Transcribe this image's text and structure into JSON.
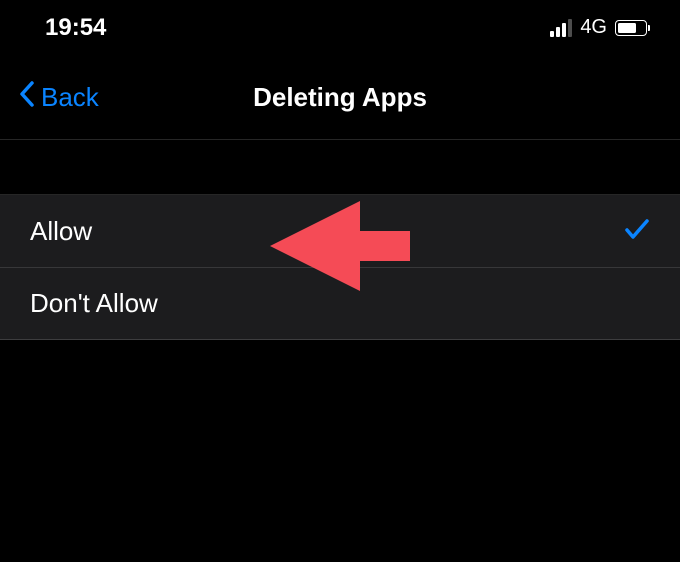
{
  "status_bar": {
    "time": "19:54",
    "network_type": "4G"
  },
  "nav": {
    "back_label": "Back",
    "title": "Deleting Apps"
  },
  "options": {
    "allow": "Allow",
    "dont_allow": "Don't Allow"
  },
  "colors": {
    "accent": "#0a84ff",
    "annotation": "#f54b56"
  }
}
